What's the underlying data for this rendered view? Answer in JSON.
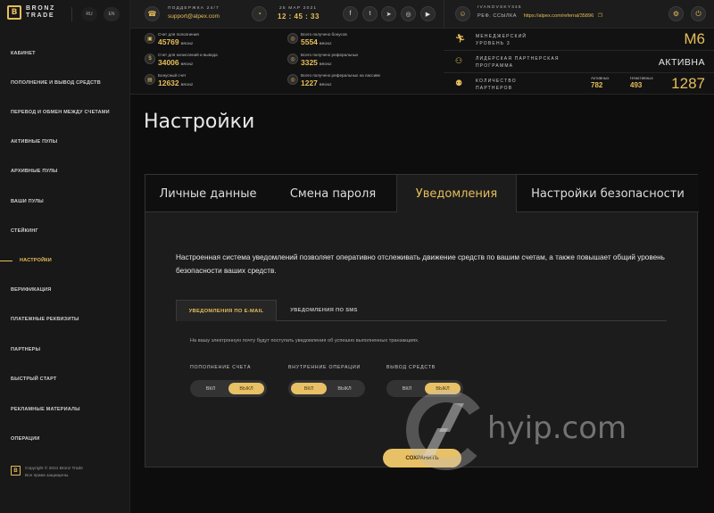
{
  "brand": {
    "line1": "BRONZ",
    "line2": "TRADE",
    "mark": "B"
  },
  "langs": [
    "RU",
    "EN"
  ],
  "sidebar": {
    "items": [
      {
        "label": "КАБИНЕТ"
      },
      {
        "label": "ПОПОЛНЕНИЕ И ВЫВОД СРЕДСТВ"
      },
      {
        "label": "ПЕРЕВОД И ОБМЕН МЕЖДУ СЧЕТАМИ"
      },
      {
        "label": "АКТИВНЫЕ ПУЛЫ"
      },
      {
        "label": "АРХИВНЫЕ ПУЛЫ"
      },
      {
        "label": "ВАШИ ПУЛЫ"
      },
      {
        "label": "СТЕЙКИНГ"
      },
      {
        "label": "НАСТРОЙКИ"
      },
      {
        "label": "ВЕРИФИКАЦИЯ"
      },
      {
        "label": "ПЛАТЕЖНЫЕ РЕКВИЗИТЫ"
      },
      {
        "label": "ПАРТНЕРЫ"
      },
      {
        "label": "БЫСТРЫЙ СТАРТ"
      },
      {
        "label": "РЕКЛАМНЫЕ МАТЕРИАЛЫ"
      },
      {
        "label": "ОПЕРАЦИИ"
      }
    ],
    "copyright1": "Copyright © 2021 Bronz Trade",
    "copyright2": "Все права защищены."
  },
  "topbar": {
    "support_label": "ПОДДЕРЖКА 24/7",
    "support_email": "support@alpex.com",
    "date": "25 МАР 2021",
    "time": "12 : 45 : 33",
    "username": "IVANOVSKY345",
    "ref_label": "РЕФ. ССЫЛКА",
    "ref_link": "https://alpex.com/referral/35896"
  },
  "stats": [
    {
      "label": "Счет для пополнения",
      "value": "45769",
      "cur": "BRONZ"
    },
    {
      "label": "Всего получено бонусов",
      "value": "5554",
      "cur": "BRONZ"
    },
    {
      "label": "Счет для начислений и вывода",
      "value": "34006",
      "cur": "BRONZ"
    },
    {
      "label": "Всего получено реферальных",
      "value": "3325",
      "cur": "BRONZ"
    },
    {
      "label": "Бонусный счет",
      "value": "12632",
      "cur": "BRONZ"
    },
    {
      "label": "Всего получено реферальных на пассиве",
      "value": "1227",
      "cur": "BRONZ"
    }
  ],
  "rank": {
    "manager_l1": "МЕНЕДЖЕРСКИЙ",
    "manager_l2": "УРОВЕНЬ 3",
    "manager_val": "M6",
    "leader_l1": "ЛИДЕРСКАЯ ПАРТНЕРСКАЯ",
    "leader_l2": "ПРОГРАММА",
    "leader_val": "АКТИВНА",
    "partners_l1": "КОЛИЧЕСТВО",
    "partners_l2": "ПАРТНЕРОВ",
    "active_label": "Активных",
    "active_val": "782",
    "inactive_label": "Неактивных",
    "inactive_val": "493",
    "partners_total": "1287"
  },
  "page": {
    "title": "Настройки",
    "tabs": [
      "Личные данные",
      "Смена пароля",
      "Уведомления",
      "Настройки безопасности"
    ],
    "description": "Настроенная система уведомлений позволяет оперативно отслеживать движение средств по вашим счетам, а также повышает общий уровень безопасности ваших средств.",
    "subtabs": [
      "УВЕДОМЛЕНИЯ ПО E-MAIL",
      "УВЕДОМЛЕНИЯ ПО SMS"
    ],
    "note": "На вашу электронную почту будут поступать уведомления об успешно выполненных транзакциях.",
    "groups": [
      {
        "label": "ПОПОЛНЕНИЕ СЧЕТА",
        "on": "ВКЛ",
        "off": "ВЫКЛ",
        "selected": "ВЫКЛ"
      },
      {
        "label": "ВНУТРЕННИЕ ОПЕРАЦИИ",
        "on": "ВКЛ",
        "off": "ВЫКЛ",
        "selected": "ВКЛ"
      },
      {
        "label": "ВЫВОД СРЕДСТВ",
        "on": "ВКЛ",
        "off": "ВЫКЛ",
        "selected": "ВЫКЛ"
      }
    ],
    "save_label": "СОХРАНИТЬ"
  },
  "watermark": "hyip.com",
  "colors": {
    "accent": "#e7be5a",
    "background": "#0e0e0e",
    "sidebar": "#181818"
  }
}
